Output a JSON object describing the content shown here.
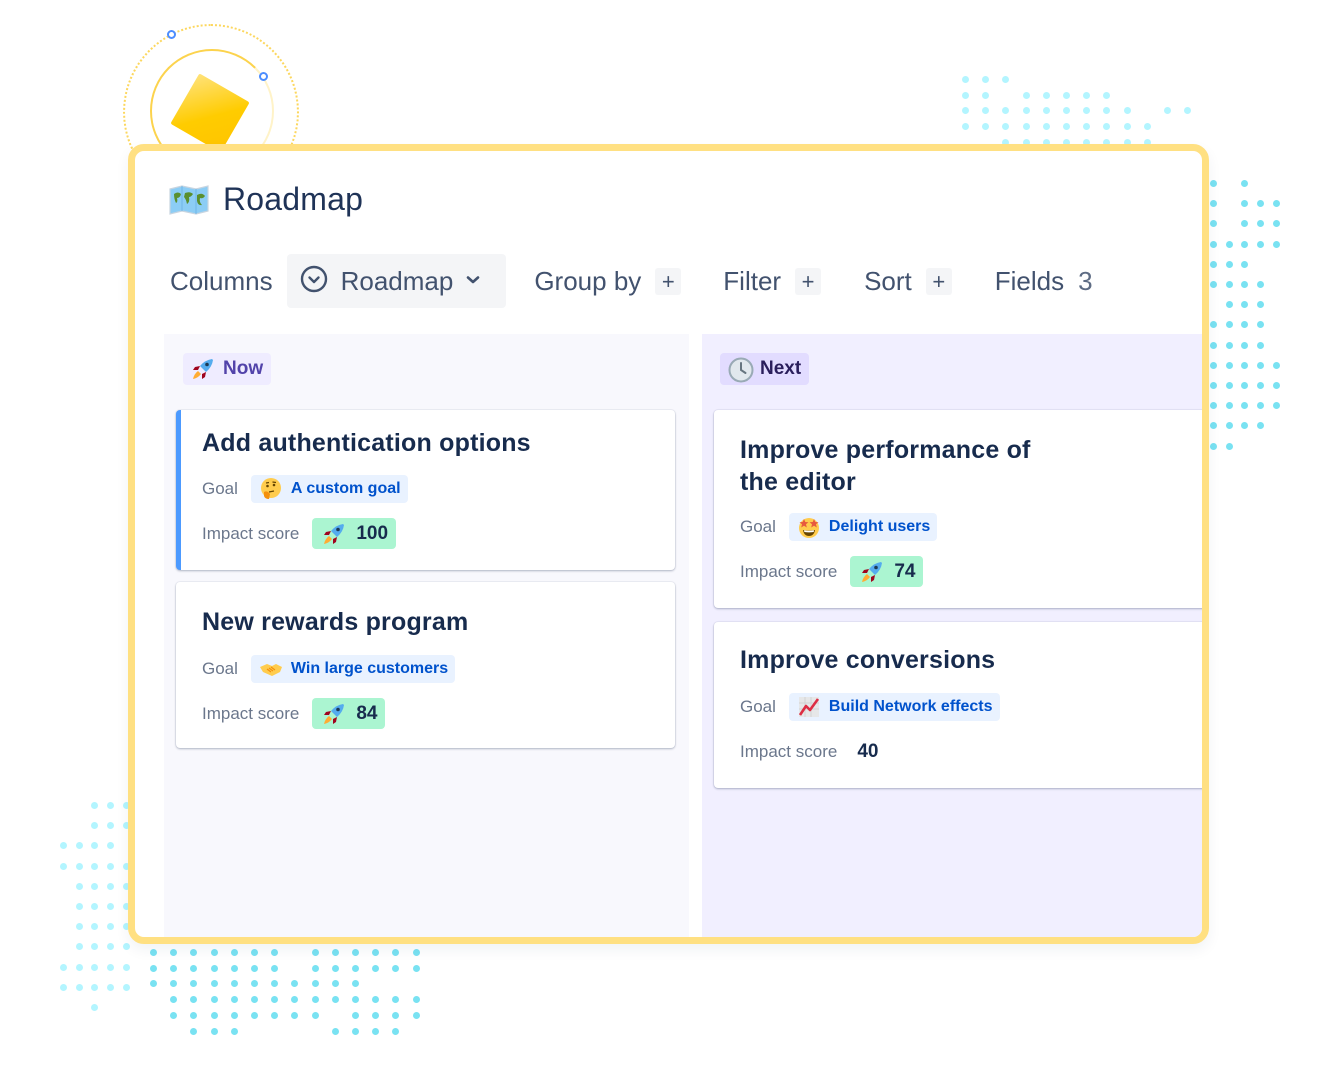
{
  "page": {
    "title": "Roadmap",
    "title_icon": "world-map-icon"
  },
  "toolbar": {
    "columns_label": "Columns",
    "columns_value": "Roadmap",
    "columns_icon": "circle-chevron-down-icon",
    "group_by_label": "Group by",
    "filter_label": "Filter",
    "sort_label": "Sort",
    "fields_label": "Fields",
    "fields_count": "3",
    "plus_symbol": "+"
  },
  "columns": [
    {
      "label": "Now",
      "icon": "rocket-icon",
      "cards": [
        {
          "title": "Add authentication options",
          "selected": true,
          "goal_label": "Goal",
          "goal": "A custom goal",
          "goal_icon": "thinking-face-icon",
          "impact_label": "Impact score",
          "impact": "100",
          "impact_icon": "rocket-icon"
        },
        {
          "title": "New rewards program",
          "goal_label": "Goal",
          "goal": "Win large customers",
          "goal_icon": "handshake-icon",
          "impact_label": "Impact score",
          "impact": "84",
          "impact_icon": "rocket-icon"
        }
      ]
    },
    {
      "label": "Next",
      "icon": "clock-icon",
      "cards": [
        {
          "title_line1": "Improve performance of",
          "title_line2": "the editor",
          "goal_label": "Goal",
          "goal": "Delight users",
          "goal_icon": "star-struck-icon",
          "impact_label": "Impact score",
          "impact": "74",
          "impact_icon": "rocket-icon"
        },
        {
          "title": "Improve conversions",
          "goal_label": "Goal",
          "goal": "Build Network effects",
          "goal_icon": "chart-increasing-icon",
          "impact_label": "Impact score",
          "impact": "40"
        }
      ]
    }
  ],
  "colors": {
    "frame_border": "#ffe082",
    "selected_accent": "#4c9aff",
    "goal_pill_bg": "#e9f2ff",
    "goal_text": "#0052cc",
    "score_pill_bg": "#abf5d1",
    "now_column_bg": "#f8f8fd",
    "next_column_bg": "#f1efff",
    "dots": "#79e2f2"
  }
}
